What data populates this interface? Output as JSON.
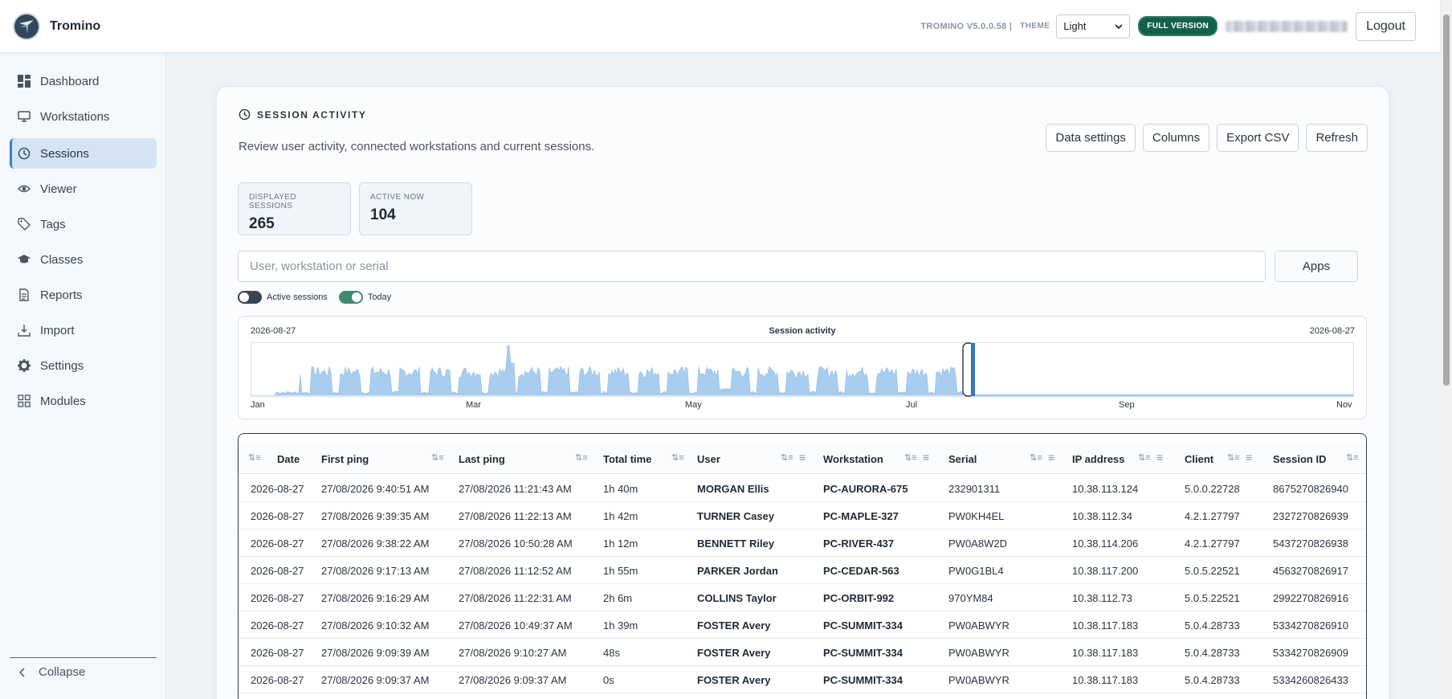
{
  "app": {
    "name": "Tromino"
  },
  "header": {
    "version": "TROMINO V5.0.0.58 |",
    "theme_label": "THEME",
    "theme_value": "Light",
    "license_badge": "FULL VERSION",
    "logout_label": "Logout"
  },
  "sidebar": {
    "items": [
      {
        "label": "Dashboard",
        "icon": "dashboard-icon"
      },
      {
        "label": "Workstations",
        "icon": "monitor-icon"
      },
      {
        "label": "Sessions",
        "icon": "clock-icon",
        "active": true
      },
      {
        "label": "Viewer",
        "icon": "eye-icon"
      },
      {
        "label": "Tags",
        "icon": "tag-icon"
      },
      {
        "label": "Classes",
        "icon": "graduation-cap-icon"
      },
      {
        "label": "Reports",
        "icon": "document-icon"
      },
      {
        "label": "Import",
        "icon": "import-icon"
      },
      {
        "label": "Settings",
        "icon": "gear-icon"
      },
      {
        "label": "Modules",
        "icon": "grid-icon"
      }
    ],
    "collapse_label": "Collapse"
  },
  "page": {
    "title": "SESSION ACTIVITY",
    "description": "Review user activity, connected workstations and current sessions.",
    "toolbar": {
      "data_settings": "Data settings",
      "columns": "Columns",
      "export_csv": "Export CSV",
      "refresh": "Refresh"
    },
    "stats": [
      {
        "label": "DISPLAYED SESSIONS",
        "value": "265"
      },
      {
        "label": "ACTIVE NOW",
        "value": "104"
      }
    ],
    "search": {
      "placeholder": "User, workstation or serial"
    },
    "apps_label": "Apps",
    "toggles": [
      {
        "label": "Active sessions",
        "on": false
      },
      {
        "label": "Today",
        "on": true
      }
    ]
  },
  "chart_data": {
    "type": "area",
    "title": "Session activity",
    "range_start_label": "2026-08-27",
    "range_end_label": "2026-08-27",
    "x_ticks": [
      "Jan",
      "Mar",
      "May",
      "Jul",
      "Sep",
      "Nov"
    ],
    "selected_range": {
      "start": "2026-08-27",
      "end": "2026-08-27"
    },
    "series_color": "#a9cdef",
    "selection_color": "#2e78c7"
  },
  "table": {
    "columns": [
      "Date",
      "First ping",
      "Last ping",
      "Total time",
      "User",
      "Workstation",
      "Serial",
      "IP address",
      "Client",
      "Session ID"
    ],
    "rows": [
      [
        "2026-08-27",
        "27/08/2026 9:40:51 AM",
        "27/08/2026 11:21:43 AM",
        "1h 40m",
        "MORGAN Ellis",
        "PC-AURORA-675",
        "232901311",
        "10.38.113.124",
        "5.0.0.22728",
        "8675270826940"
      ],
      [
        "2026-08-27",
        "27/08/2026 9:39:35 AM",
        "27/08/2026 11:22:13 AM",
        "1h 42m",
        "TURNER Casey",
        "PC-MAPLE-327",
        "PW0KH4EL",
        "10.38.112.34",
        "4.2.1.27797",
        "2327270826939"
      ],
      [
        "2026-08-27",
        "27/08/2026 9:38:22 AM",
        "27/08/2026 10:50:28 AM",
        "1h 12m",
        "BENNETT Riley",
        "PC-RIVER-437",
        "PW0A8W2D",
        "10.38.114.206",
        "4.2.1.27797",
        "5437270826938"
      ],
      [
        "2026-08-27",
        "27/08/2026 9:17:13 AM",
        "27/08/2026 11:12:52 AM",
        "1h 55m",
        "PARKER Jordan",
        "PC-CEDAR-563",
        "PW0G1BL4",
        "10.38.117.200",
        "5.0.5.22521",
        "4563270826917"
      ],
      [
        "2026-08-27",
        "27/08/2026 9:16:29 AM",
        "27/08/2026 11:22:31 AM",
        "2h 6m",
        "COLLINS Taylor",
        "PC-ORBIT-992",
        "970YM84",
        "10.38.112.73",
        "5.0.5.22521",
        "2992270826916"
      ],
      [
        "2026-08-27",
        "27/08/2026 9:10:32 AM",
        "27/08/2026 10:49:37 AM",
        "1h 39m",
        "FOSTER Avery",
        "PC-SUMMIT-334",
        "PW0ABWYR",
        "10.38.117.183",
        "5.0.4.28733",
        "5334270826910"
      ],
      [
        "2026-08-27",
        "27/08/2026 9:09:39 AM",
        "27/08/2026 9:10:27 AM",
        "48s",
        "FOSTER Avery",
        "PC-SUMMIT-334",
        "PW0ABWYR",
        "10.38.117.183",
        "5.0.4.28733",
        "5334270826909"
      ],
      [
        "2026-08-27",
        "27/08/2026 9:09:37 AM",
        "27/08/2026 9:09:37 AM",
        "0s",
        "FOSTER Avery",
        "PC-SUMMIT-334",
        "PW0ABWYR",
        "10.38.117.183",
        "5.0.4.28733",
        "5334260826433"
      ]
    ]
  }
}
